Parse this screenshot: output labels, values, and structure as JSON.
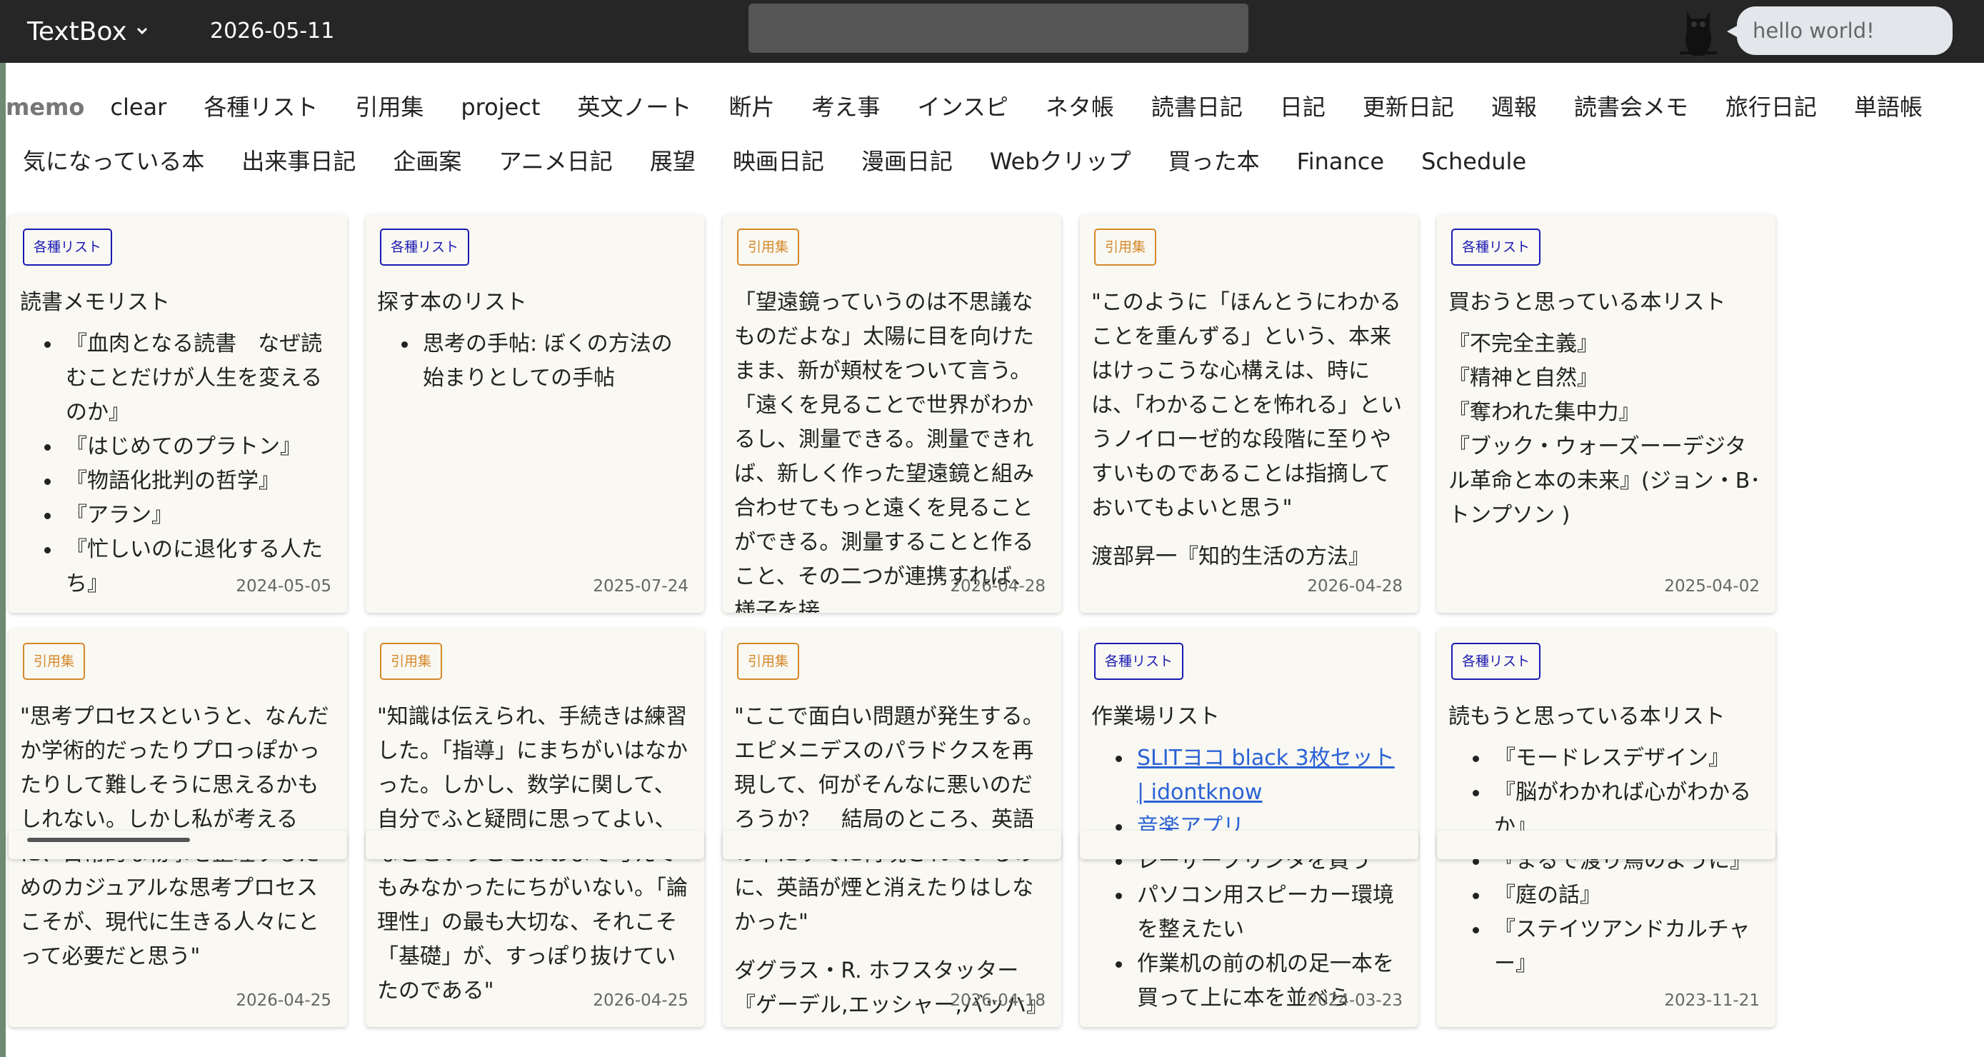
{
  "app": {
    "title": "TextBox",
    "date": "2026-05-11",
    "search_placeholder": "",
    "bubble_text": "hello world!",
    "colors": {
      "topbar": "#262626",
      "badge_list": "#1a1ab3",
      "badge_quote": "#d4892a",
      "card_bg": "#f9f8f2",
      "link": "#2a62d6"
    }
  },
  "nav": {
    "memo": "memo",
    "row1": [
      "clear",
      "各種リスト",
      "引用集",
      "project",
      "英文ノート",
      "断片",
      "考え事",
      "インスピ",
      "ネタ帳",
      "読書日記",
      "日記",
      "更新日記",
      "週報",
      "読書会メモ",
      "旅行日記",
      "単語帳"
    ],
    "row2": [
      "気になっている本",
      "出来事日記",
      "企画案",
      "アニメ日記",
      "展望",
      "映画日記",
      "漫画日記",
      "Webクリップ",
      "買った本",
      "Finance",
      "Schedule"
    ]
  },
  "cards": [
    {
      "tag": "各種リスト",
      "title": "読書メモリスト",
      "items": [
        "『血肉となる読書　なぜ読むことだけが人生を変えるのか』",
        "『はじめてのプラトン』",
        "『物語化批判の哲学』",
        "『アラン』",
        "『忙しいのに退化する人たち』"
      ],
      "date": "2024-05-05"
    },
    {
      "tag": "各種リスト",
      "title": "探す本のリスト",
      "items": [
        "思考の手帖: ぼくの方法の始まりとしての手帖"
      ],
      "date": "2025-07-24"
    },
    {
      "tag": "引用集",
      "text": "「望遠鏡っていうのは不思議なものだよな」太陽に目を向けたまま、新が頬杖をついて言う。「遠くを見ることで世界がわかるし、測量できる。測量できれば、新しく作った望遠鏡と組み合わせてもっと遠くを見ることができる。測量することと作ること、その二つが連携すれば、様子を接",
      "date": "2026-04-28"
    },
    {
      "tag": "引用集",
      "text": "\"このように「ほんとうにわかることを重んずる」という、本来はけっこうな心構えは、時には、「わかることを怖れる」というノイローゼ的な段階に至りやすいものであることは指摘しておいてもよいと思う\"",
      "source": "渡部昇一『知的生活の方法』",
      "date": "2026-04-28"
    },
    {
      "tag": "各種リスト",
      "title": "買おうと思っている本リスト",
      "lines": [
        "『不完全主義』",
        "『精神と自然』",
        "『奪われた集中力』",
        "『ブック・ウォーズーーデジタル革命と本の未来』(ジョン・B･トンプソン )"
      ],
      "date": "2025-04-02"
    },
    {
      "tag": "引用集",
      "text": "\"思考プロセスというと、なんだか学術的だったりプロっぽかったりして難しそうに思えるかもしれない。しかし私が考えるに、日常的な物事を整理するためのカジュアルな思考プロセスこそが、現代に生きる人々にとって必要だと思う\"",
      "date": "2026-04-25"
    },
    {
      "tag": "引用集",
      "text": "\"知識は伝えられ、手続きは練習した。「指導」にまちがいはなかった。しかし、数学に関して、自分でふと疑問に思ってよい、などということはおよそ考えてもみなかったにちがいない。「論理性」の最も大切な、それこそ「基礎」が、すっぽり抜けていたのである\"",
      "date": "2026-04-25"
    },
    {
      "tag": "引用集",
      "text": "\"ここで面白い問題が発生する。エピメニデスのパラドクスを再現して、何がそんなに悪いのだろうか？　結局のところ、英語の中にすでに再現されているのに、英語が煙と消えたりはしなかった\"",
      "source": "ダグラス・R. ホフスタッター『ゲーデル,エッシャー,バッハ』",
      "date": "2026-04-18"
    },
    {
      "tag": "各種リスト",
      "title": "作業場リスト",
      "links": [
        "SLITヨコ black 3枚セット | idontknow",
        "音楽アプリ"
      ],
      "items": [
        "レーザープリンタを買う",
        "パソコン用スピーカー環境を整えたい",
        "作業机の前の机の足一本を買って上に本を並べら"
      ],
      "date": "2024-03-23"
    },
    {
      "tag": "各種リスト",
      "title": "読もうと思っている本リスト",
      "items": [
        "『モードレスデザイン』",
        "『脳がわかれば心がわかるか』",
        "『まるで渡り鳥のように』",
        "『庭の話』",
        "『ステイツアンドカルチャー』"
      ],
      "date": "2023-11-21"
    }
  ]
}
